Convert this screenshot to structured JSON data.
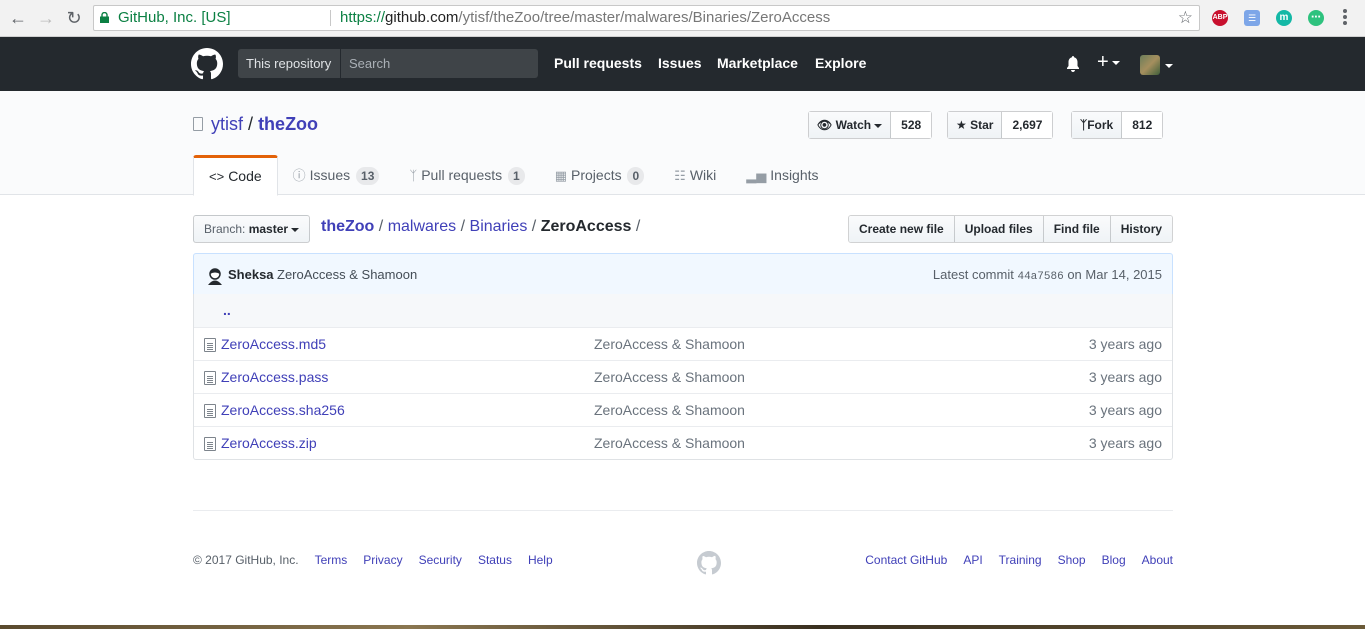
{
  "browser": {
    "secure_label": "GitHub, Inc. [US]",
    "url_scheme": "https://",
    "url_host": "github.com",
    "url_path": "/ytisf/theZoo/tree/master/malwares/Binaries/ZeroAccess",
    "extensions": [
      "ABP",
      "translate",
      "m",
      "chat"
    ]
  },
  "header": {
    "scope": "This repository",
    "search_placeholder": "Search",
    "nav": [
      "Pull requests",
      "Issues",
      "Marketplace",
      "Explore"
    ],
    "plus": "+"
  },
  "repo": {
    "owner": "ytisf",
    "sep": "/",
    "name": "theZoo",
    "watch_label": "Watch",
    "watch_count": "528",
    "star_label": "Star",
    "star_count": "2,697",
    "fork_label": "Fork",
    "fork_count": "812"
  },
  "tabs": {
    "code": "Code",
    "issues": "Issues",
    "issues_count": "13",
    "pulls": "Pull requests",
    "pulls_count": "1",
    "projects": "Projects",
    "projects_count": "0",
    "wiki": "Wiki",
    "insights": "Insights"
  },
  "filenav": {
    "branch_prefix": "Branch:",
    "branch": "master",
    "crumbs": [
      "theZoo",
      "malwares",
      "Binaries"
    ],
    "current": "ZeroAccess",
    "sep": "/",
    "buttons": [
      "Create new file",
      "Upload files",
      "Find file",
      "History"
    ]
  },
  "commit": {
    "author": "Sheksa",
    "message": "ZeroAccess & Shamoon",
    "latest_prefix": "Latest commit",
    "sha": "44a7586",
    "date": "on Mar 14, 2015"
  },
  "files": {
    "up": "..",
    "rows": [
      {
        "name": "ZeroAccess.md5",
        "message": "ZeroAccess & Shamoon",
        "age": "3 years ago"
      },
      {
        "name": "ZeroAccess.pass",
        "message": "ZeroAccess & Shamoon",
        "age": "3 years ago"
      },
      {
        "name": "ZeroAccess.sha256",
        "message": "ZeroAccess & Shamoon",
        "age": "3 years ago"
      },
      {
        "name": "ZeroAccess.zip",
        "message": "ZeroAccess & Shamoon",
        "age": "3 years ago"
      }
    ]
  },
  "footer": {
    "copyright": "© 2017 GitHub, Inc.",
    "left_links": [
      "Terms",
      "Privacy",
      "Security",
      "Status",
      "Help"
    ],
    "right_links": [
      "Contact GitHub",
      "API",
      "Training",
      "Shop",
      "Blog",
      "About"
    ]
  },
  "colors": {
    "header_bg": "#24292e",
    "link": "#4040b8",
    "tab_accent": "#e36209"
  }
}
